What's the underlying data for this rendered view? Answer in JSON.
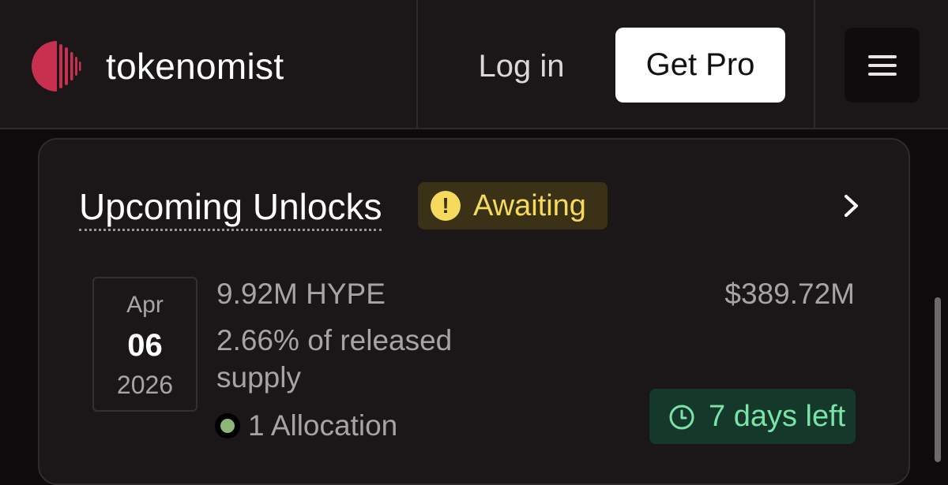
{
  "header": {
    "brand": "tokenomist",
    "login_label": "Log in",
    "get_pro_label": "Get Pro",
    "logo_icon": "tokenomist-logo-icon",
    "menu_icon": "hamburger-menu-icon",
    "brand_color": "#c7304f"
  },
  "unlocks": {
    "title": "Upcoming Unlocks",
    "status_badge": "Awaiting",
    "status_icon": "exclamation-icon",
    "chevron_icon": "chevron-right-icon",
    "event": {
      "month": "Apr",
      "day": "06",
      "year": "2026",
      "amount": "9.92M HYPE",
      "percent_text": "2.66% of released supply",
      "allocation": "1 Allocation",
      "value": "$389.72M",
      "time_left": "7 days left",
      "clock_icon": "clock-icon"
    }
  }
}
